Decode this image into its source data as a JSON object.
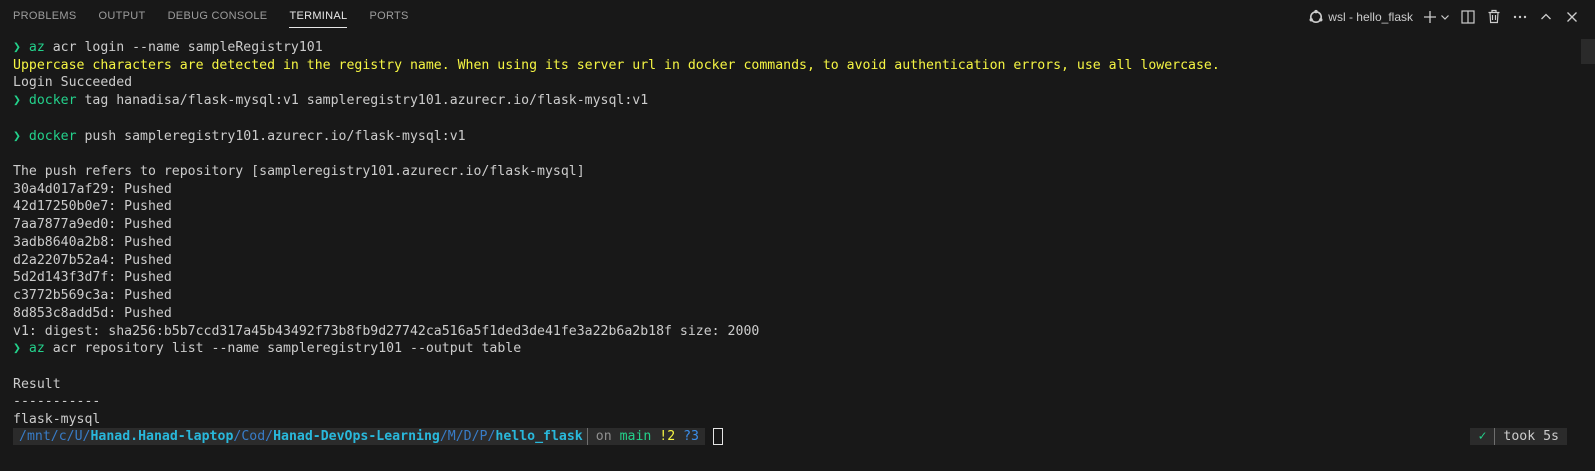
{
  "panel": {
    "tabs": [
      {
        "label": "PROBLEMS",
        "active": false
      },
      {
        "label": "OUTPUT",
        "active": false
      },
      {
        "label": "DEBUG CONSOLE",
        "active": false
      },
      {
        "label": "TERMINAL",
        "active": true
      },
      {
        "label": "PORTS",
        "active": false
      }
    ],
    "profile_label": "wsl - hello_flask",
    "icons": [
      "linux-icon",
      "plus-icon",
      "chevron-down-icon",
      "split-icon",
      "trash-icon",
      "more-icon",
      "chevron-up-icon",
      "close-icon"
    ]
  },
  "terminal": {
    "prompt_symbol": "❯",
    "lines": [
      {
        "prompt": "❯ ",
        "cmd": "az",
        "rest": " acr login --name sampleRegistry101"
      },
      {
        "warn": "Uppercase characters are detected in the registry name. When using its server url in docker commands, to avoid authentication errors, use all lowercase."
      },
      {
        "text": "Login Succeeded"
      },
      {
        "prompt": "❯ ",
        "cmd": "docker",
        "rest": " tag hanadisa/flask-mysql:v1 sampleregistry101.azurecr.io/flask-mysql:v1"
      },
      {
        "text": ""
      },
      {
        "prompt": "❯ ",
        "cmd": "docker",
        "rest": " push sampleregistry101.azurecr.io/flask-mysql:v1"
      },
      {
        "text": ""
      },
      {
        "text": "The push refers to repository [sampleregistry101.azurecr.io/flask-mysql]"
      },
      {
        "text": "30a4d017af29: Pushed"
      },
      {
        "text": "42d17250b0e7: Pushed"
      },
      {
        "text": "7aa7877a9ed0: Pushed"
      },
      {
        "text": "3adb8640a2b8: Pushed"
      },
      {
        "text": "d2a2207b52a4: Pushed"
      },
      {
        "text": "5d2d143f3d7f: Pushed"
      },
      {
        "text": "c3772b569c3a: Pushed"
      },
      {
        "text": "8d853c8add5d: Pushed"
      },
      {
        "text": "v1: digest: sha256:b5b7ccd317a45b43492f73b8fb9d27742ca516a5f1ded3de41fe3a22b6a2b18f size: 2000"
      },
      {
        "prompt": "❯ ",
        "cmd": "az",
        "rest": " acr repository list --name sampleregistry101 --output table"
      },
      {
        "text": ""
      },
      {
        "text": "Result"
      },
      {
        "text": "-----------"
      },
      {
        "text": "flask-mysql"
      }
    ],
    "status": {
      "path_parts": [
        {
          "text": "/mnt/c/U/",
          "bold": false
        },
        {
          "text": "Hanad.Hanad-laptop",
          "bold": true
        },
        {
          "text": "/Cod/",
          "bold": false
        },
        {
          "text": "Hanad-DevOps-Learning",
          "bold": true
        },
        {
          "text": "/M/D/P/",
          "bold": false
        },
        {
          "text": "hello_flask",
          "bold": true
        }
      ],
      "git_on": "on ",
      "git_branch": "main",
      "git_modified": " !2",
      "git_untracked": " ?3",
      "check": "✓",
      "took": "took 5s"
    }
  },
  "colors": {
    "background": "#181818",
    "prompt_green": "#23d18b",
    "warning_yellow": "#f5f543",
    "path_blue": "#3b8eea"
  }
}
